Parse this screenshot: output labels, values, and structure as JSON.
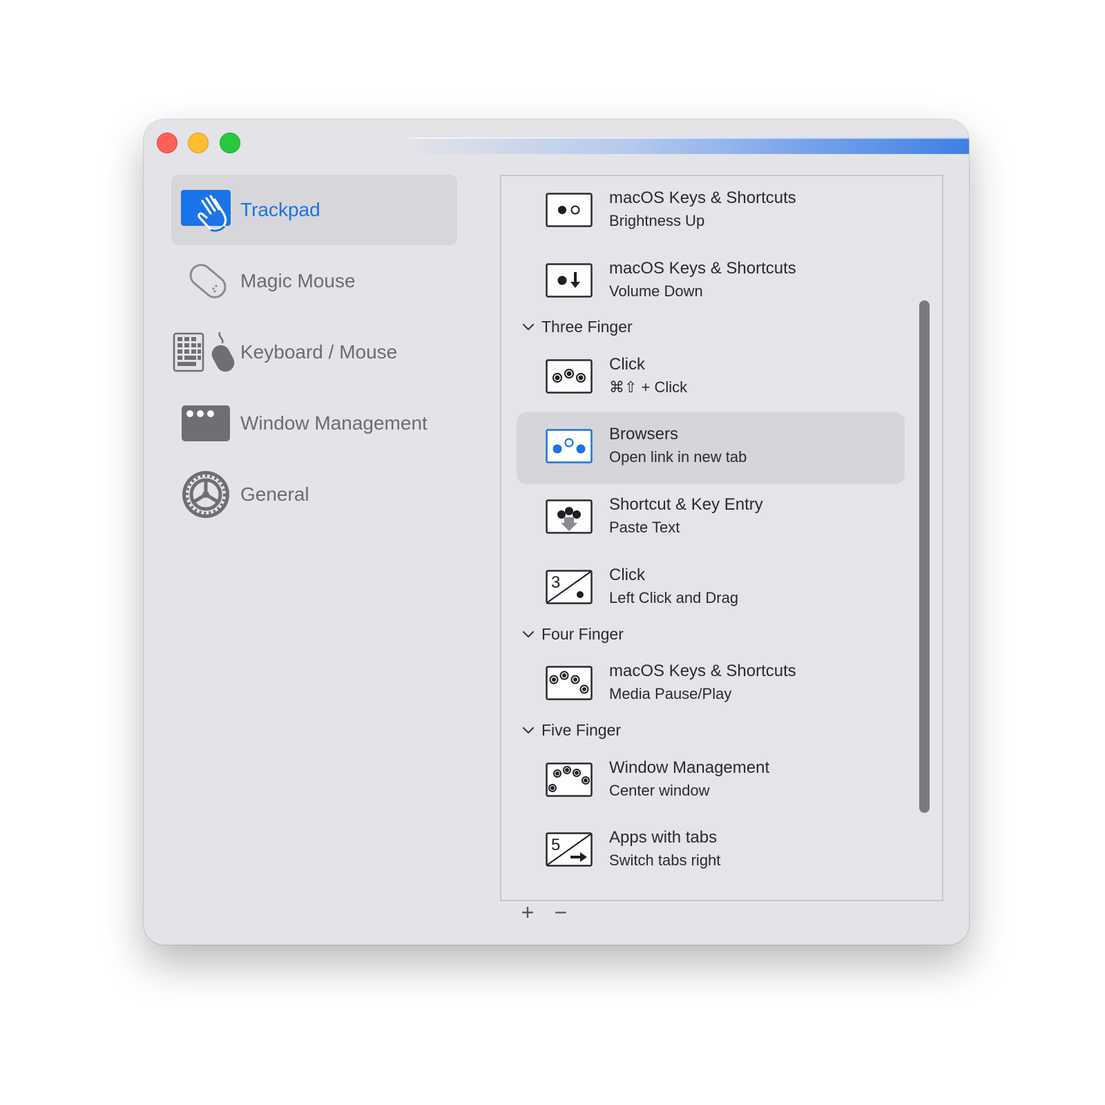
{
  "window": {
    "controls": [
      "close",
      "minimize",
      "zoom"
    ]
  },
  "sidebar": {
    "items": [
      {
        "label": "Trackpad",
        "icon": "trackpad-hand-icon",
        "selected": true
      },
      {
        "label": "Magic Mouse",
        "icon": "magic-mouse-icon",
        "selected": false
      },
      {
        "label": "Keyboard / Mouse",
        "icon": "keyboard-mouse-icon",
        "selected": false
      },
      {
        "label": "Window Management",
        "icon": "window-icon",
        "selected": false
      },
      {
        "label": "General",
        "icon": "gear-icon",
        "selected": false
      }
    ],
    "accent_color": "#1a73e8"
  },
  "list": {
    "rows": [
      {
        "title": "macOS Keys & Shortcuts",
        "subtitle": "Brightness Up",
        "icon": "two-dots-icon"
      },
      {
        "title": "macOS Keys & Shortcuts",
        "subtitle": "Volume Down",
        "icon": "dot-arrow-down-icon"
      },
      {
        "title": "Click",
        "subtitle": "⌘⇧ + Click",
        "icon": "three-finger-click-icon"
      },
      {
        "title": "Browsers",
        "subtitle": "Open link in new tab",
        "icon": "three-finger-tap-icon",
        "selected": true
      },
      {
        "title": "Shortcut & Key Entry",
        "subtitle": "Paste Text",
        "icon": "three-finger-swipe-down-icon"
      },
      {
        "title": "Click",
        "subtitle": "Left Click and Drag",
        "icon": "three-finger-drag-icon"
      },
      {
        "title": "macOS Keys & Shortcuts",
        "subtitle": "Media Pause/Play",
        "icon": "four-finger-click-icon"
      },
      {
        "title": "Window Management",
        "subtitle": "Center window",
        "icon": "five-finger-click-icon"
      },
      {
        "title": "Apps with tabs",
        "subtitle": "Switch tabs right",
        "icon": "five-finger-swipe-right-icon"
      }
    ],
    "groups": [
      {
        "label": "Three Finger"
      },
      {
        "label": "Four Finger"
      },
      {
        "label": "Five Finger"
      }
    ],
    "icon_numbers": {
      "three": "3",
      "five": "5"
    }
  },
  "toolbar": {
    "add_label": "+",
    "remove_label": "−"
  }
}
